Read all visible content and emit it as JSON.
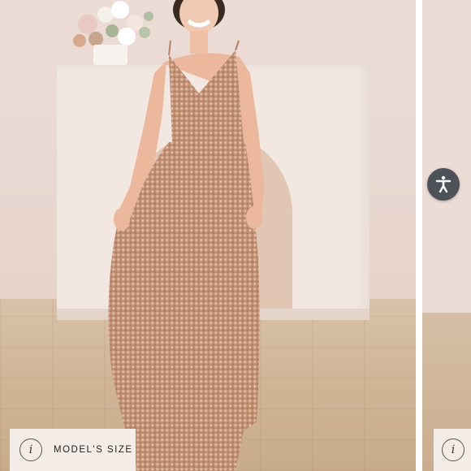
{
  "gallery": {
    "size_badge": {
      "info_glyph": "i",
      "label": "MODEL'S SIZE"
    },
    "next_badge": {
      "info_glyph": "i"
    }
  },
  "accessibility": {
    "icon": "accessibility-icon"
  },
  "colors": {
    "dress": "#c9987a",
    "wall": "#ecdcd6",
    "floor": "#cfb596",
    "badge_bg": "#f4ece6",
    "a11y_bg": "#4d5158"
  }
}
